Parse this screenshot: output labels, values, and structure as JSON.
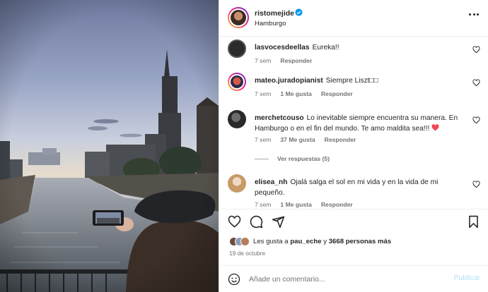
{
  "post": {
    "username": "ristomejide",
    "location": "Hamburgo",
    "verified": true,
    "date": "19 de octubre"
  },
  "comments": [
    {
      "user": "lasvocesdeellas",
      "text": "Eureka!!",
      "time": "7 sem",
      "likes": "",
      "reply": "Responder",
      "avatar_color": "#2b2b2b"
    },
    {
      "user": "mateo.juradopianist",
      "text": "Siempre Liszt□□",
      "time": "7 sem",
      "likes": "1 Me gusta",
      "reply": "Responder",
      "avatar_color": "#c44a3a"
    },
    {
      "user": "merchetcouso",
      "text": "Lo inevitable siempre encuentra su manera. En Hamburgo o en el fin del mundo. Te amo maldita sea!!!",
      "time": "7 sem",
      "likes": "37 Me gusta",
      "reply": "Responder",
      "avatar_color": "#3a3a3a",
      "view_replies": "Ver respuestas (5)"
    },
    {
      "user": "elisea_nh",
      "text": "Ojalá salga el sol en mi vida y en la vida de mi pequeño.",
      "time": "7 sem",
      "likes": "1 Me gusta",
      "reply": "Responder",
      "avatar_color": "#d9b48a"
    }
  ],
  "likes": {
    "prefix": "Les gusta a",
    "user": "pau_eche",
    "connector": "y",
    "others": "3668 personas más"
  },
  "add_comment": {
    "placeholder": "Añade un comentario...",
    "publish_label": "Publicar"
  },
  "colors": {
    "accent": "#0095f6",
    "verified": "#0095f6",
    "heart_red": "#ed4956",
    "muted": "#737373"
  },
  "icons": [
    "more-options-icon",
    "verified-badge-icon",
    "like-icon",
    "comment-icon",
    "share-icon",
    "save-icon",
    "emoji-icon"
  ]
}
